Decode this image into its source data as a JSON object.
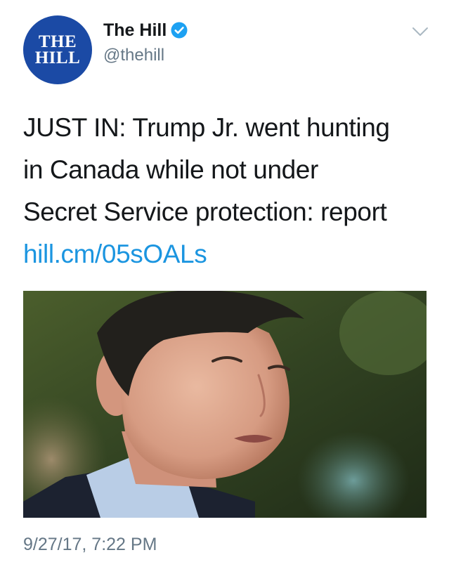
{
  "account": {
    "avatar_line1": "THE",
    "avatar_line2": "HILL",
    "display_name": "The Hill",
    "handle": "@thehill",
    "verified": true
  },
  "tweet": {
    "text_lines": [
      "JUST IN: Trump Jr. went hunting",
      "in Canada while not under",
      "Secret Service protection: report"
    ],
    "link": "hill.cm/05sOALs",
    "timestamp": "9/27/17, 7:22 PM"
  },
  "icons": {
    "verified": "verified-badge-icon",
    "menu": "chevron-down-icon"
  },
  "colors": {
    "avatar_bg": "#1b4aa5",
    "link": "#1b95e0",
    "verified": "#1da1f2",
    "muted": "#657786"
  }
}
